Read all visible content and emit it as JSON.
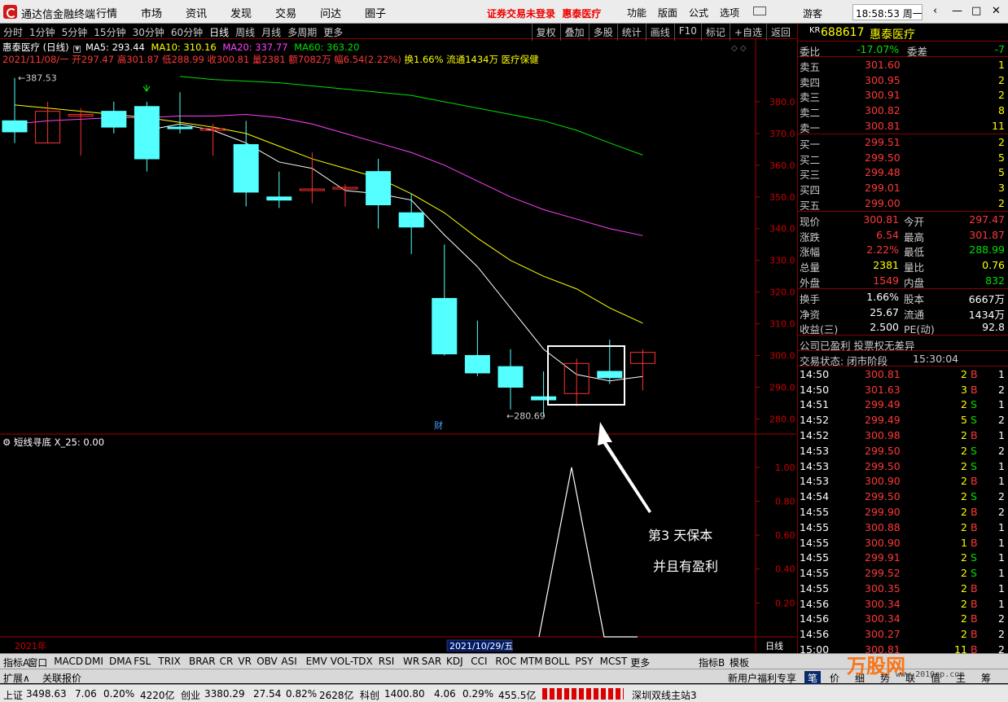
{
  "titlebar": {
    "app_title": "通达信金融终端",
    "menu": [
      "行情",
      "市场",
      "资讯",
      "发现",
      "交易",
      "问达",
      "圈子"
    ],
    "notice": "证券交易未登录",
    "stock_name": "惠泰医疗",
    "menu2": [
      "功能",
      "版面",
      "公式",
      "选项"
    ],
    "guest": "游客",
    "clock": "18:58:53 周一"
  },
  "toolbar": {
    "periods": [
      "分时",
      "1分钟",
      "5分钟",
      "15分钟",
      "30分钟",
      "60分钟",
      "日线",
      "周线",
      "月线",
      "多周期",
      "更多"
    ],
    "active": "日线",
    "right": [
      "复权",
      "叠加",
      "多股",
      "统计",
      "画线",
      "F10",
      "标记",
      "+自选",
      "返回"
    ]
  },
  "chart": {
    "header": "惠泰医疗 (日线)",
    "ma5_label": "MA5: 293.44",
    "ma10_label": "MA10: 310.16",
    "ma20_label": "MA20: 337.77",
    "ma60_label": "MA60: 363.20",
    "info_line_prefix": "2021/11/08/一 开297.47 高301.87 低288.99 收300.81 量2381 额7082万 幅6.54(2.22%)",
    "info_line_rest": " 换1.66% 流通1434万 医疗保健",
    "high_mark": "387.53",
    "low_mark": "280.69",
    "cai_mark": "财",
    "y_ticks": [
      "380.0",
      "370.0",
      "360.0",
      "350.0",
      "340.0",
      "330.0",
      "320.0",
      "310.0",
      "300.0",
      "290.0",
      "280.0"
    ],
    "indicator_label": "短线寻底 X_25: 0.00",
    "ind_ticks": [
      "1.00",
      "0.80",
      "0.60",
      "0.40",
      "0.20"
    ],
    "x_year": "2021年",
    "x_date": "2021/10/29/五",
    "period_tag": "日线",
    "annotation": [
      "第3 天保本",
      "并且有盈利"
    ],
    "colors": {
      "up": "#ff3232",
      "down": "#54ffff",
      "ma5": "#ffffff",
      "ma10": "#ffff00",
      "ma20": "#ff40ff",
      "ma60": "#00e000"
    }
  },
  "chart_data": {
    "type": "candlestick",
    "ylim": [
      276,
      390
    ],
    "candles": [
      {
        "o": 374,
        "h": 387.5,
        "l": 367,
        "c": 370.5
      },
      {
        "o": 367,
        "h": 380,
        "l": 367,
        "c": 377
      },
      {
        "o": 375.5,
        "h": 378,
        "l": 363,
        "c": 376
      },
      {
        "o": 377,
        "h": 380,
        "l": 370,
        "c": 372
      },
      {
        "o": 378.5,
        "h": 380,
        "l": 358,
        "c": 362
      },
      {
        "o": 372,
        "h": 383,
        "l": 370,
        "c": 371.5
      },
      {
        "o": 371,
        "h": 373,
        "l": 363,
        "c": 371.5
      },
      {
        "o": 366.5,
        "h": 374,
        "l": 347,
        "c": 351.5
      },
      {
        "o": 350,
        "h": 358,
        "l": 346.5,
        "c": 349
      },
      {
        "o": 352.5,
        "h": 364,
        "l": 348,
        "c": 352.5
      },
      {
        "o": 352.5,
        "h": 354,
        "l": 347,
        "c": 353
      },
      {
        "o": 358,
        "h": 362,
        "l": 340,
        "c": 347.5
      },
      {
        "o": 345,
        "h": 351,
        "l": 332,
        "c": 340.5
      },
      {
        "o": 318,
        "h": 335,
        "l": 300,
        "c": 300.5
      },
      {
        "o": 300,
        "h": 311,
        "l": 293.5,
        "c": 294.5
      },
      {
        "o": 296.5,
        "h": 302,
        "l": 283,
        "c": 290
      },
      {
        "o": 287,
        "h": 295,
        "l": 281,
        "c": 286
      },
      {
        "o": 288,
        "h": 299,
        "l": 284,
        "c": 297.5
      },
      {
        "o": 295,
        "h": 305,
        "l": 291,
        "c": 293
      },
      {
        "o": 297.5,
        "h": 302,
        "l": 289,
        "c": 301
      }
    ],
    "ma5": [
      null,
      null,
      null,
      null,
      371,
      373,
      371,
      367,
      361,
      359,
      352,
      351,
      349,
      338,
      328,
      315,
      302,
      294,
      292,
      293.4
    ],
    "ma10": [
      379,
      378,
      377,
      376,
      375,
      373.5,
      372,
      370,
      366,
      362,
      359,
      356,
      351,
      345,
      337,
      330,
      325,
      321,
      315,
      310.2
    ],
    "ma20": [
      373,
      374,
      374.5,
      375,
      375,
      375.5,
      375.5,
      376,
      375,
      373,
      370,
      367,
      364,
      360,
      355,
      350,
      346,
      343,
      340,
      337.8
    ],
    "ma60": [
      null,
      null,
      null,
      null,
      null,
      388,
      387,
      386.5,
      386,
      385,
      384,
      383,
      382,
      380,
      378,
      376,
      374,
      371,
      367,
      363.2
    ],
    "indicator": [
      0,
      0,
      0,
      0,
      0,
      0,
      0,
      0,
      0,
      0,
      0,
      0,
      0,
      0,
      0,
      0,
      0,
      0,
      0,
      0,
      0,
      0,
      0,
      0,
      0,
      0,
      0,
      0,
      0,
      0,
      0,
      0,
      0,
      0,
      0,
      1,
      0,
      0,
      0,
      0,
      0,
      0
    ]
  },
  "quote": {
    "code_prefix": "KR",
    "code": "688617",
    "name": "惠泰医疗",
    "weibi_label": "委比",
    "weibi": "-17.07%",
    "weicha_label": "委差",
    "weicha": "-7",
    "asks": [
      {
        "label": "卖五",
        "price": "301.60",
        "vol": "1"
      },
      {
        "label": "卖四",
        "price": "300.95",
        "vol": "2"
      },
      {
        "label": "卖三",
        "price": "300.91",
        "vol": "2"
      },
      {
        "label": "卖二",
        "price": "300.82",
        "vol": "8"
      },
      {
        "label": "卖一",
        "price": "300.81",
        "vol": "11"
      }
    ],
    "bids": [
      {
        "label": "买一",
        "price": "299.51",
        "vol": "2"
      },
      {
        "label": "买二",
        "price": "299.50",
        "vol": "5"
      },
      {
        "label": "买三",
        "price": "299.48",
        "vol": "5"
      },
      {
        "label": "买四",
        "price": "299.01",
        "vol": "3"
      },
      {
        "label": "买五",
        "price": "299.00",
        "vol": "2"
      }
    ],
    "stats": [
      {
        "l1": "现价",
        "v1": "300.81",
        "l2": "今开",
        "v2": "297.47",
        "c1": "red",
        "c2": "red"
      },
      {
        "l1": "涨跌",
        "v1": "6.54",
        "l2": "最高",
        "v2": "301.87",
        "c1": "red",
        "c2": "red"
      },
      {
        "l1": "涨幅",
        "v1": "2.22%",
        "l2": "最低",
        "v2": "288.99",
        "c1": "red",
        "c2": "green"
      },
      {
        "l1": "总量",
        "v1": "2381",
        "l2": "量比",
        "v2": "0.76",
        "c1": "yellow",
        "c2": "yellow"
      },
      {
        "l1": "外盘",
        "v1": "1549",
        "l2": "内盘",
        "v2": "832",
        "c1": "red",
        "c2": "green"
      }
    ],
    "stats2": [
      {
        "l1": "换手",
        "v1": "1.66%",
        "l2": "股本",
        "v2": "6667万"
      },
      {
        "l1": "净资",
        "v1": "25.67",
        "l2": "流通",
        "v2": "1434万"
      },
      {
        "l1": "收益(三)",
        "v1": "2.500",
        "l2": "PE(动)",
        "v2": "92.8"
      }
    ],
    "company_note": "公司已盈利 投票权无差异",
    "trade_status": "交易状态: 闭市阶段",
    "trade_time": "15:30:04",
    "ticks": [
      {
        "t": "14:50",
        "p": "300.81",
        "v": "2",
        "s": "B",
        "n": "1"
      },
      {
        "t": "14:50",
        "p": "301.63",
        "v": "3",
        "s": "B",
        "n": "2"
      },
      {
        "t": "14:51",
        "p": "299.49",
        "v": "2",
        "s": "S",
        "n": "1"
      },
      {
        "t": "14:52",
        "p": "299.49",
        "v": "5",
        "s": "S",
        "n": "2"
      },
      {
        "t": "14:52",
        "p": "300.98",
        "v": "2",
        "s": "B",
        "n": "1"
      },
      {
        "t": "14:53",
        "p": "299.50",
        "v": "2",
        "s": "S",
        "n": "2"
      },
      {
        "t": "14:53",
        "p": "299.50",
        "v": "2",
        "s": "S",
        "n": "1"
      },
      {
        "t": "14:53",
        "p": "300.90",
        "v": "2",
        "s": "B",
        "n": "1"
      },
      {
        "t": "14:54",
        "p": "299.50",
        "v": "2",
        "s": "S",
        "n": "2"
      },
      {
        "t": "14:55",
        "p": "299.90",
        "v": "2",
        "s": "B",
        "n": "2"
      },
      {
        "t": "14:55",
        "p": "300.88",
        "v": "2",
        "s": "B",
        "n": "1"
      },
      {
        "t": "14:55",
        "p": "300.90",
        "v": "1",
        "s": "B",
        "n": "1"
      },
      {
        "t": "14:55",
        "p": "299.91",
        "v": "2",
        "s": "S",
        "n": "1"
      },
      {
        "t": "14:55",
        "p": "299.52",
        "v": "2",
        "s": "S",
        "n": "1"
      },
      {
        "t": "14:55",
        "p": "300.35",
        "v": "2",
        "s": "B",
        "n": "1"
      },
      {
        "t": "14:56",
        "p": "300.34",
        "v": "2",
        "s": "B",
        "n": "1"
      },
      {
        "t": "14:56",
        "p": "300.34",
        "v": "2",
        "s": "B",
        "n": "2"
      },
      {
        "t": "14:56",
        "p": "300.27",
        "v": "2",
        "s": "B",
        "n": "2"
      },
      {
        "t": "15:00",
        "p": "300.81",
        "v": "11",
        "s": "B",
        "n": "2"
      }
    ]
  },
  "bottom": {
    "indicators": [
      "指标A",
      "窗口",
      "MACD",
      "DMI",
      "DMA",
      "FSL",
      "TRIX",
      "BRAR",
      "CR",
      "VR",
      "OBV",
      "ASI",
      "EMV",
      "VOL-TDX",
      "RSI",
      "WR",
      "SAR",
      "KDJ",
      "CCI",
      "ROC",
      "MTM",
      "BOLL",
      "PSY",
      "MCST",
      "更多"
    ],
    "right_tabs": [
      "指标B",
      "模板"
    ],
    "row2_left": [
      "扩展∧",
      "关联报价"
    ],
    "row2_right": "新用户福利专享",
    "row2_tabs": [
      "笔",
      "价",
      "细",
      "势",
      "联",
      "值",
      "主",
      "筹"
    ],
    "watermark": "万股网",
    "watermark_url": "www.2010gp.com"
  },
  "statusbar": {
    "items": [
      "上证",
      "3498.63",
      "7.06",
      "0.20%",
      "4220亿",
      "创业",
      "3380.29",
      "27.54",
      "0.82%",
      "2628亿",
      "科创",
      "1400.80",
      "4.06",
      "0.29%",
      "455.5亿"
    ],
    "station": "深圳双线主站3"
  }
}
